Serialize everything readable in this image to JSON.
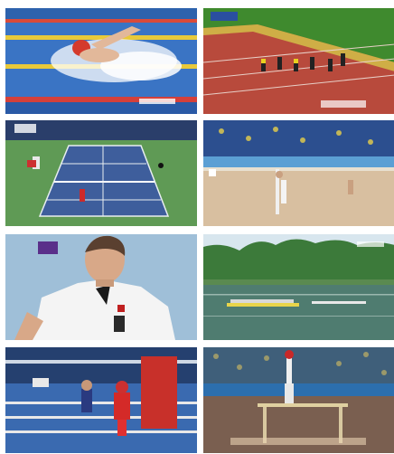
{
  "grid": {
    "columns": 2,
    "rows": 4,
    "tiles": [
      {
        "icon": "swimming-scene"
      },
      {
        "icon": "sprint-race-scene"
      },
      {
        "icon": "tennis-match-scene"
      },
      {
        "icon": "beach-volleyball-scene"
      },
      {
        "icon": "athlete-portrait-scene"
      },
      {
        "icon": "rowing-regatta-scene"
      },
      {
        "icon": "boxing-bout-scene"
      },
      {
        "icon": "gymnastics-parallel-bars-scene"
      }
    ]
  }
}
